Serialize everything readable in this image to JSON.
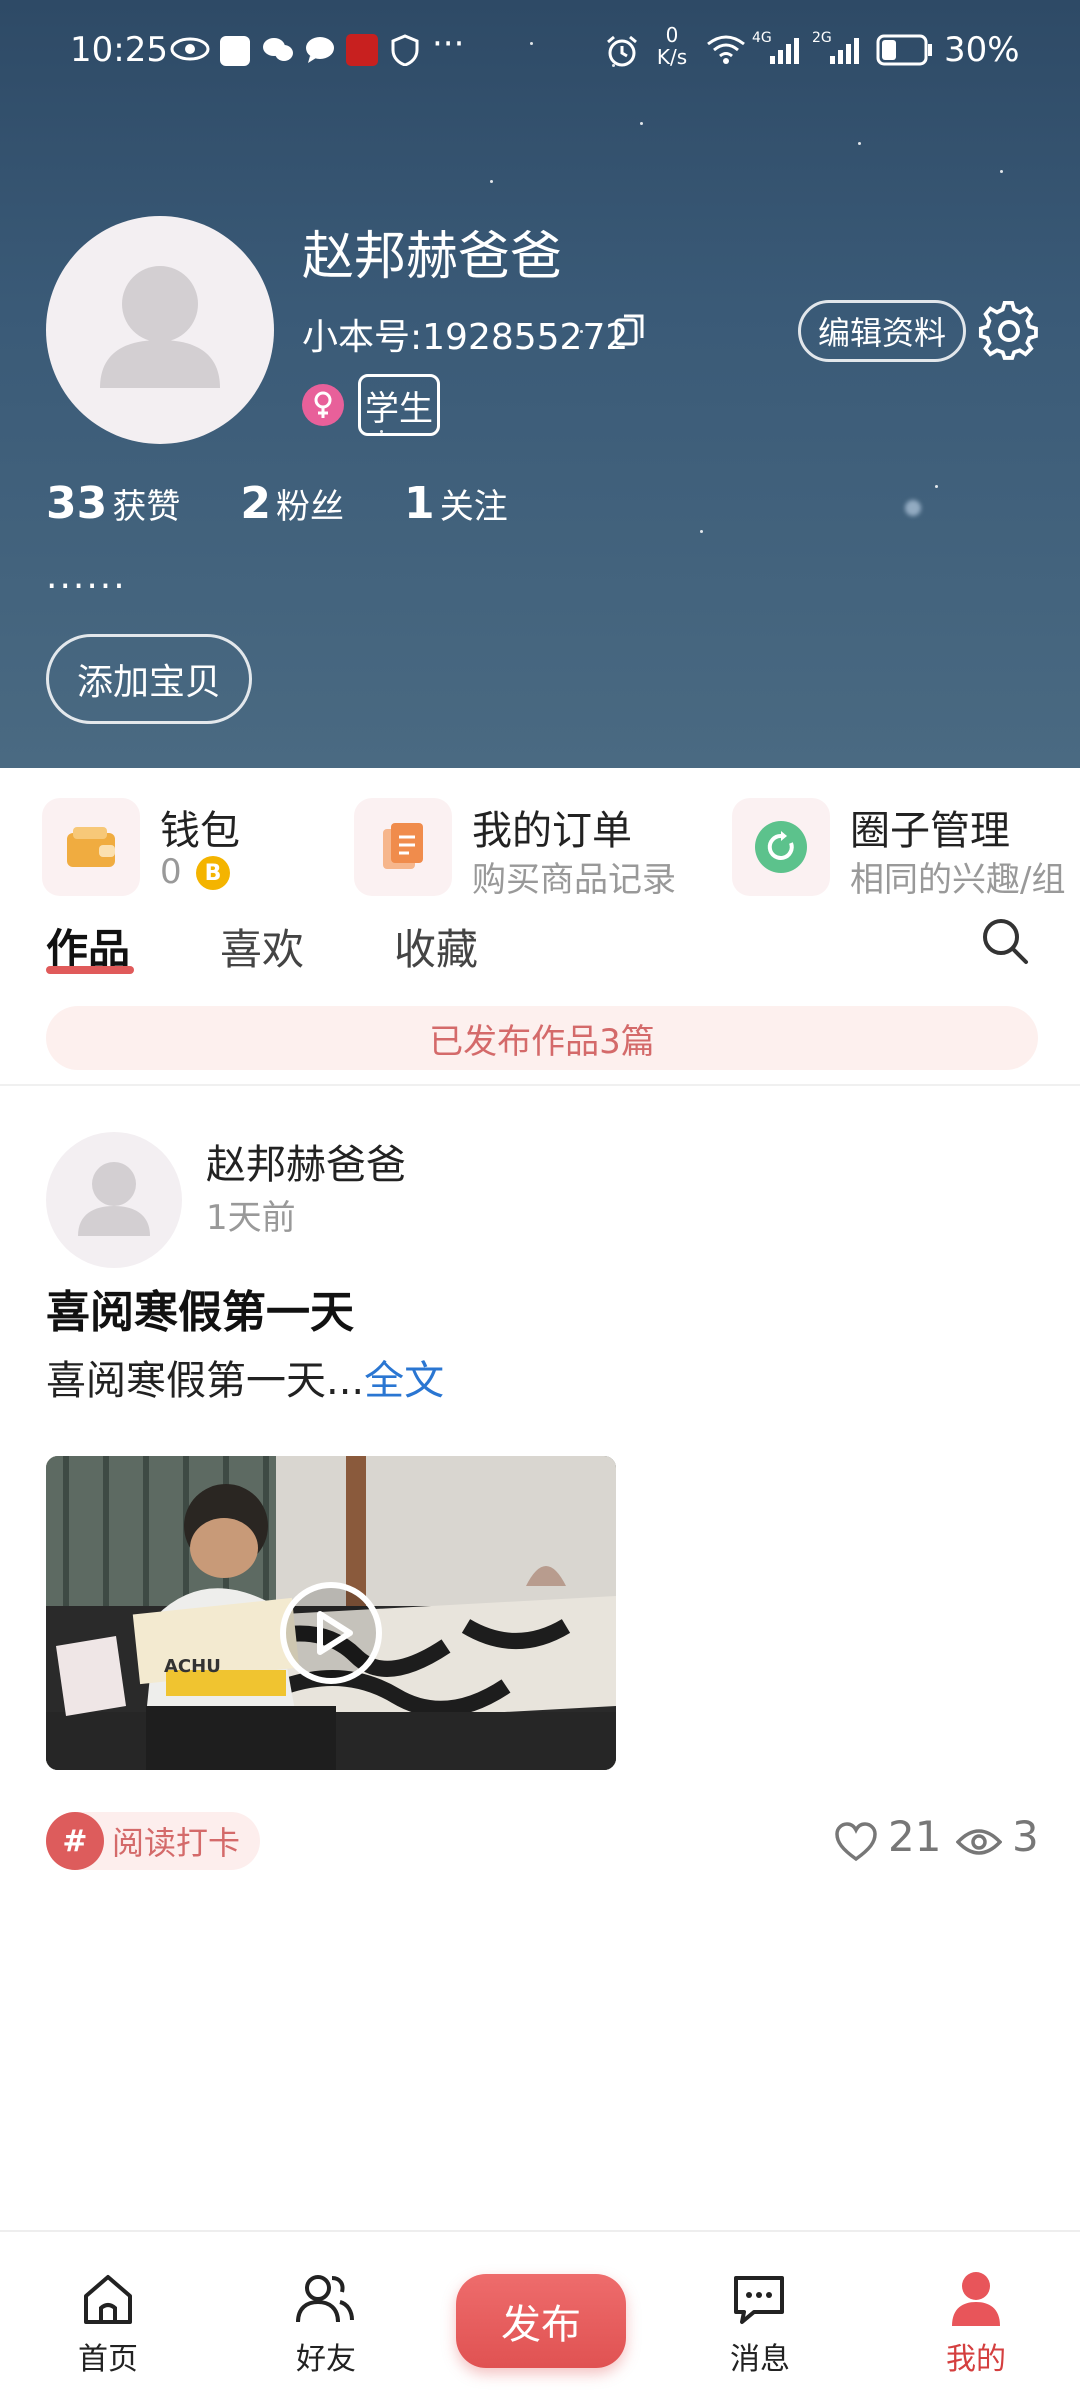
{
  "status_bar": {
    "time": "10:25",
    "more": "···",
    "net_speed_value": "0",
    "net_speed_unit": "K/s",
    "signal1_label": "4G",
    "signal2_label": "2G",
    "battery": "30%"
  },
  "profile": {
    "name": "赵邦赫爸爸",
    "account_id": "小本号:192855272",
    "edit_button": "编辑资料",
    "role_badge": "学生",
    "stats": [
      {
        "count": "33",
        "label": "获赞"
      },
      {
        "count": "2",
        "label": "粉丝"
      },
      {
        "count": "1",
        "label": "关注"
      }
    ],
    "bio": "......",
    "add_baby_button": "添加宝贝"
  },
  "quick_entries": [
    {
      "title": "钱包",
      "sub": "0",
      "icon": "wallet-icon"
    },
    {
      "title": "我的订单",
      "sub": "购买商品记录",
      "icon": "order-icon"
    },
    {
      "title": "圈子管理",
      "sub": "相同的兴趣/组",
      "icon": "circle-icon"
    }
  ],
  "tabs": {
    "works": "作品",
    "likes": "喜欢",
    "favorites": "收藏"
  },
  "published_banner": "已发布作品3篇",
  "post": {
    "author": "赵邦赫爸爸",
    "time": "1天前",
    "title": "喜阅寒假第一天",
    "excerpt": "喜阅寒假第一天...",
    "full_text_link": "全文",
    "tag_symbol": "#",
    "tag": "阅读打卡",
    "likes": "21",
    "views": "3",
    "video_caption": "ACHU"
  },
  "bottom_nav": {
    "home": "首页",
    "friends": "好友",
    "publish": "发布",
    "messages": "消息",
    "mine": "我的"
  },
  "colors": {
    "accent": "#e05a5a",
    "link": "#2a76d2",
    "header_bg": "#3a5a77"
  }
}
